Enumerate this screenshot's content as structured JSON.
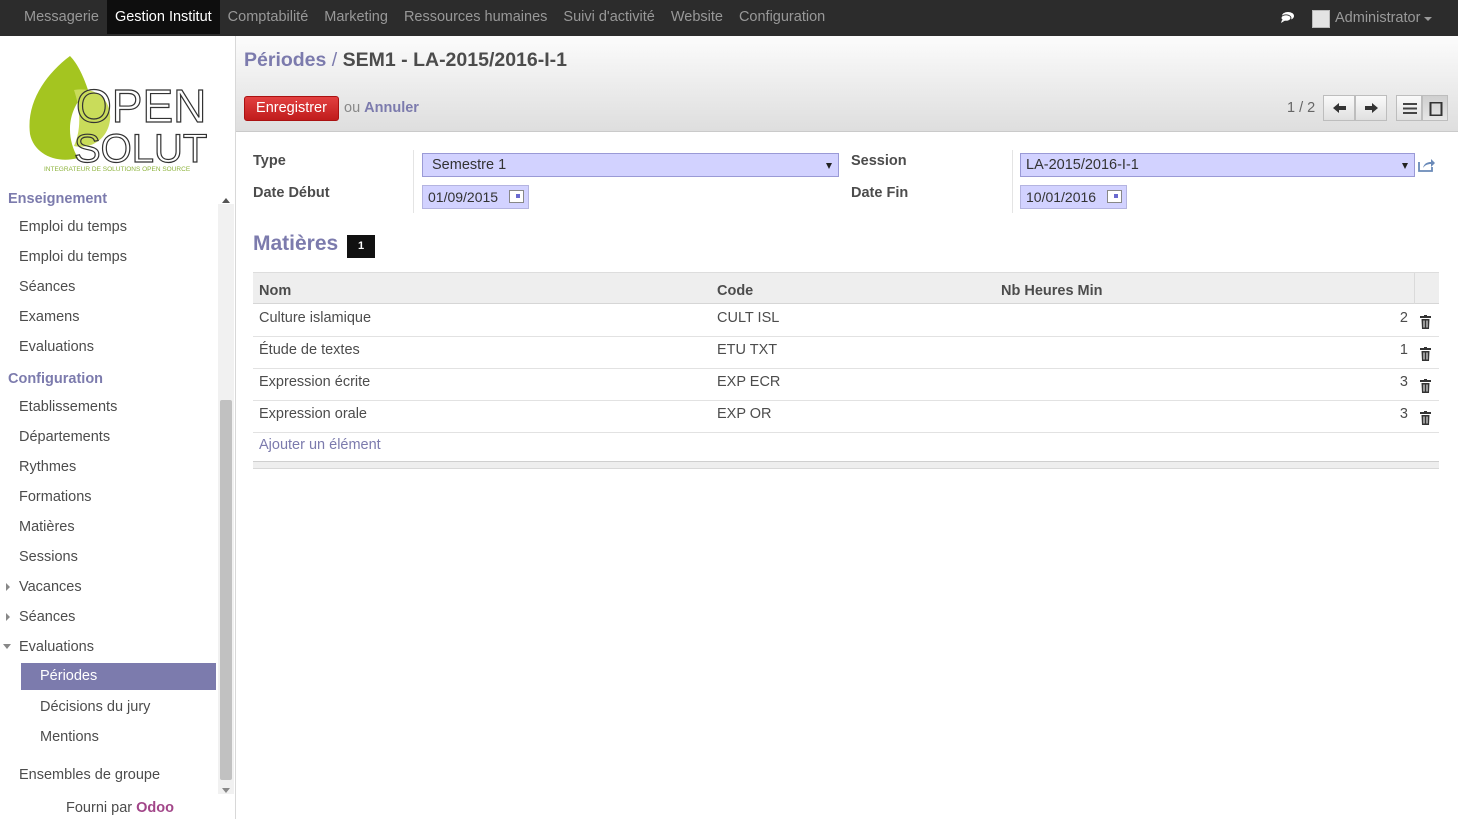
{
  "topbar": {
    "menu": [
      "Messagerie",
      "Gestion Institut",
      "Comptabilité",
      "Marketing",
      "Ressources humaines",
      "Suivi d'activité",
      "Website",
      "Configuration"
    ],
    "active_index": 1,
    "user": "Administrator"
  },
  "sidebar": {
    "logo_line1": "OPEN",
    "logo_line2": "SOLUTIS",
    "logo_tagline": "INTEGRATEUR DE SOLUTIONS OPEN SOURCE",
    "sections": [
      {
        "title": "Enseignement",
        "items": [
          "Emploi du temps",
          "Emploi du temps",
          "Séances",
          "Examens",
          "Evaluations"
        ]
      },
      {
        "title": "Configuration",
        "items": [
          "Etablissements",
          "Départements",
          "Rythmes",
          "Formations",
          "Matières",
          "Sessions",
          "Vacances",
          "Séances",
          "Evaluations"
        ]
      }
    ],
    "sub_items": [
      "Périodes",
      "Décisions du jury",
      "Mentions"
    ],
    "extra_item": "Ensembles de groupe",
    "powered_prefix": "Fourni par",
    "powered_brand": "Odoo"
  },
  "breadcrumb": {
    "parent": "Périodes",
    "separator": "/",
    "current": "SEM1 - LA-2015/2016-I-1"
  },
  "actions": {
    "save": "Enregistrer",
    "or": "ou",
    "cancel": "Annuler"
  },
  "pager": {
    "text": "1 / 2"
  },
  "form": {
    "type_label": "Type",
    "type_value": "Semestre 1",
    "session_label": "Session",
    "session_value": "LA-2015/2016-I-1",
    "date_start_label": "Date Début",
    "date_start_value": "01/09/2015",
    "date_end_label": "Date Fin",
    "date_end_value": "10/01/2016"
  },
  "subjects": {
    "title": "Matières",
    "count": "1",
    "columns": [
      "Nom",
      "Code",
      "Nb Heures Min"
    ],
    "rows": [
      {
        "name": "Culture islamique",
        "code": "CULT ISL",
        "hours": "2"
      },
      {
        "name": "Étude de textes",
        "code": "ETU TXT",
        "hours": "1"
      },
      {
        "name": "Expression écrite",
        "code": "EXP ECR",
        "hours": "3"
      },
      {
        "name": "Expression orale",
        "code": "EXP OR",
        "hours": "3"
      }
    ],
    "add_label": "Ajouter un élément"
  },
  "colors": {
    "accent": "#7c7bad",
    "save": "#d52a2a",
    "topbar": "#2c2c2c",
    "field_bg": "#d2d2ff",
    "brand": "#a24689"
  },
  "icons": [
    "chat-icon",
    "trash-icon",
    "calendar-icon",
    "external-link-icon",
    "arrow-left-icon",
    "arrow-right-icon",
    "list-view-icon",
    "form-view-icon"
  ]
}
